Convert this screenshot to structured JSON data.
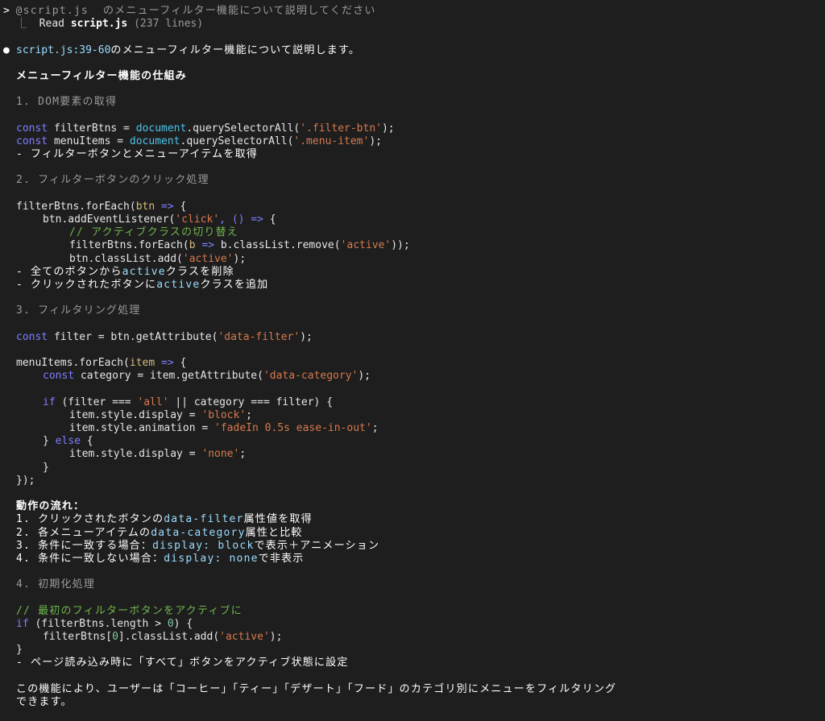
{
  "prompt": {
    "chevron": ">",
    "text": "@script.js  のメニューフィルター機能について説明してください"
  },
  "tool": {
    "tree_char": "⎿",
    "action": "Read",
    "file": "script.js",
    "detail": "(237 lines)"
  },
  "answer": {
    "bullet": "●",
    "ref": "script.js:39-60",
    "intro": "のメニューフィルター機能について説明します。",
    "heading": "メニューフィルター機能の仕組み"
  },
  "sections": {
    "s1": "1. DOM要素の取得",
    "s2": "2. フィルターボタンのクリック処理",
    "s3": "3. フィルタリング処理",
    "s4": "4. 初期化処理"
  },
  "code1": {
    "l1": {
      "kw": "const",
      "a": " filterBtns = ",
      "doc": "document",
      "b": ".querySelectorAll(",
      "str": "'.filter-btn'",
      "c": ");"
    },
    "l2": {
      "kw": "const",
      "a": " menuItems = ",
      "doc": "document",
      "b": ".querySelectorAll(",
      "str": "'.menu-item'",
      "c": ");"
    },
    "note": "- フィルターボタンとメニューアイテムを取得"
  },
  "code2": {
    "l1": {
      "a": "filterBtns.forEach(",
      "param": "btn",
      "arrow": " =>",
      "b": " {"
    },
    "l2": {
      "a": "btn.addEventListener(",
      "str": "'click'",
      "b": ", () =>",
      "c": " {"
    },
    "l3": "// アクティブクラスの切り替え",
    "l4": {
      "a": "filterBtns.forEach(",
      "param": "b",
      "arrow": " =>",
      "b": " b.classList.remove(",
      "str": "'active'",
      "c": "));"
    },
    "l5": {
      "a": "btn.classList.add(",
      "str": "'active'",
      "b": ");"
    },
    "note1": {
      "a": "- 全てのボタンから",
      "code": "active",
      "b": "クラスを削除"
    },
    "note2": {
      "a": "- クリックされたボタンに",
      "code": "active",
      "b": "クラスを追加"
    }
  },
  "code3": {
    "l1": {
      "kw": "const",
      "a": " filter = btn.getAttribute(",
      "str": "'data-filter'",
      "b": ");"
    },
    "l2": {
      "a": "menuItems.forEach(",
      "param": "item",
      "arrow": " =>",
      "b": " {"
    },
    "l3": {
      "kw": "const",
      "a": " category = item.getAttribute(",
      "str": "'data-category'",
      "b": ");"
    },
    "l4": {
      "kw": "if",
      "a": " (filter === ",
      "str": "'all'",
      "b": " || category === filter) {"
    },
    "l5": {
      "a": "item.style.display = ",
      "str": "'block'",
      "b": ";"
    },
    "l6": {
      "a": "item.style.animation = ",
      "str": "'fadeIn 0.5s ease-in-out'",
      "b": ";"
    },
    "l7": {
      "a": "} ",
      "kw": "else",
      "b": " {"
    },
    "l8": {
      "a": "item.style.display = ",
      "str": "'none'",
      "b": ";"
    },
    "l9": "}",
    "l10": "});"
  },
  "flow": {
    "heading": "動作の流れ：",
    "i1": {
      "a": "1. クリックされたボタンの",
      "code": "data-filter",
      "b": "属性値を取得"
    },
    "i2": {
      "a": "2. 各メニューアイテムの",
      "code": "data-category",
      "b": "属性と比較"
    },
    "i3": {
      "a": "3. 条件に一致する場合：",
      "code": "display: block",
      "b": "で表示＋アニメーション"
    },
    "i4": {
      "a": "4. 条件に一致しない場合：",
      "code": "display: none",
      "b": "で非表示"
    }
  },
  "code4": {
    "comment": "// 最初のフィルターボタンをアクティブに",
    "l1": {
      "kw": "if",
      "a": " (filterBtns.length > ",
      "num": "0",
      "b": ") {"
    },
    "l2": {
      "a": "filterBtns[",
      "num": "0",
      "b": "].classList.add(",
      "str": "'active'",
      "c": ");"
    },
    "l3": "}",
    "note": "- ページ読み込み時に「すべて」ボタンをアクティブ状態に設定"
  },
  "summary": {
    "l1": "この機能により、ユーザーは「コーヒー」「ティー」「デザート」「フード」のカテゴリ別にメニューをフィルタリング",
    "l2": "できます。"
  },
  "colors": {
    "background": "#1e1e1e",
    "keyword": "#7f7dff",
    "string": "#d6794d",
    "number": "#7cc7a0",
    "param": "#d7ba7d",
    "comment": "#71b64d",
    "path": "#9cdcfe"
  }
}
